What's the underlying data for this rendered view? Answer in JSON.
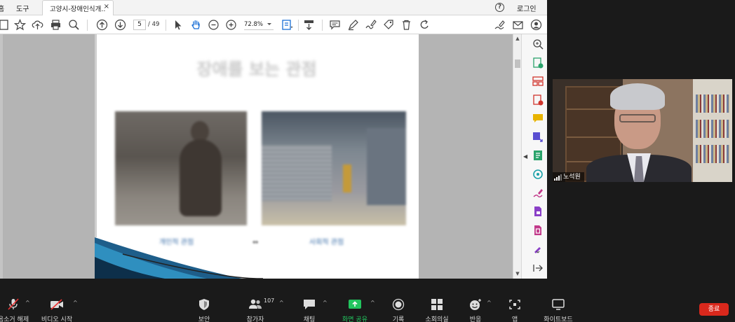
{
  "acrobat": {
    "menu": [
      "홈",
      "도구"
    ],
    "tab_title": "고양시-장애인식개...",
    "tab_close": "×",
    "help": "?",
    "login": "로그인",
    "page_current": "5",
    "page_total": "/ 49",
    "zoom_level": "72.8%",
    "icons": [
      "save-icon",
      "bookmark-star-icon",
      "upload-cloud-icon",
      "print-icon",
      "search-zoom-icon",
      "page-up-icon",
      "page-down-icon",
      "select-cursor-icon",
      "hand-pan-icon",
      "zoom-out-icon",
      "zoom-in-icon",
      "fit-page-icon",
      "scroll-mode-icon",
      "comment-icon",
      "highlight-pen-icon",
      "draw-sign-icon",
      "tag-edit-icon",
      "delete-icon",
      "undo-icon",
      "fill-sign-icon",
      "email-icon",
      "account-icon"
    ]
  },
  "slide": {
    "title": "장애를 보는 관점",
    "caption_left": "개인적 관점",
    "caption_sep": "⇔",
    "caption_right": "사회적 관점"
  },
  "right_panel": {
    "icons": [
      "search-zoom-icon",
      "export-pdf-icon",
      "organize-pages-icon",
      "create-pdf-icon",
      "comment-icon",
      "combine-files-icon",
      "edit-pdf-icon",
      "scan-ocr-icon",
      "fill-sign-icon",
      "protect-icon",
      "compress-pdf-icon",
      "more-tools-icon",
      "expand-panel-icon"
    ]
  },
  "video": {
    "participant_name": "노석원"
  },
  "zoom_toolbar": {
    "items": [
      {
        "label": "음소거 해제",
        "icon": "mic-muted-icon"
      },
      {
        "label": "비디오 시작",
        "icon": "video-off-icon"
      },
      {
        "label": "보안",
        "icon": "shield-icon"
      },
      {
        "label": "참가자",
        "icon": "participants-icon"
      },
      {
        "label": "채팅",
        "icon": "chat-icon"
      },
      {
        "label": "화면 공유",
        "icon": "share-screen-icon"
      },
      {
        "label": "기록",
        "icon": "record-icon"
      },
      {
        "label": "소회의실",
        "icon": "breakout-rooms-icon"
      },
      {
        "label": "반응",
        "icon": "reactions-icon"
      },
      {
        "label": "앱",
        "icon": "apps-icon"
      },
      {
        "label": "화이트보드",
        "icon": "whiteboard-icon"
      }
    ],
    "participant_count": "107",
    "end_label": "종료"
  },
  "colors": {
    "share_green": "#22c55e",
    "end_red": "#d9281c",
    "caption_blue": "#3a6ea8"
  }
}
